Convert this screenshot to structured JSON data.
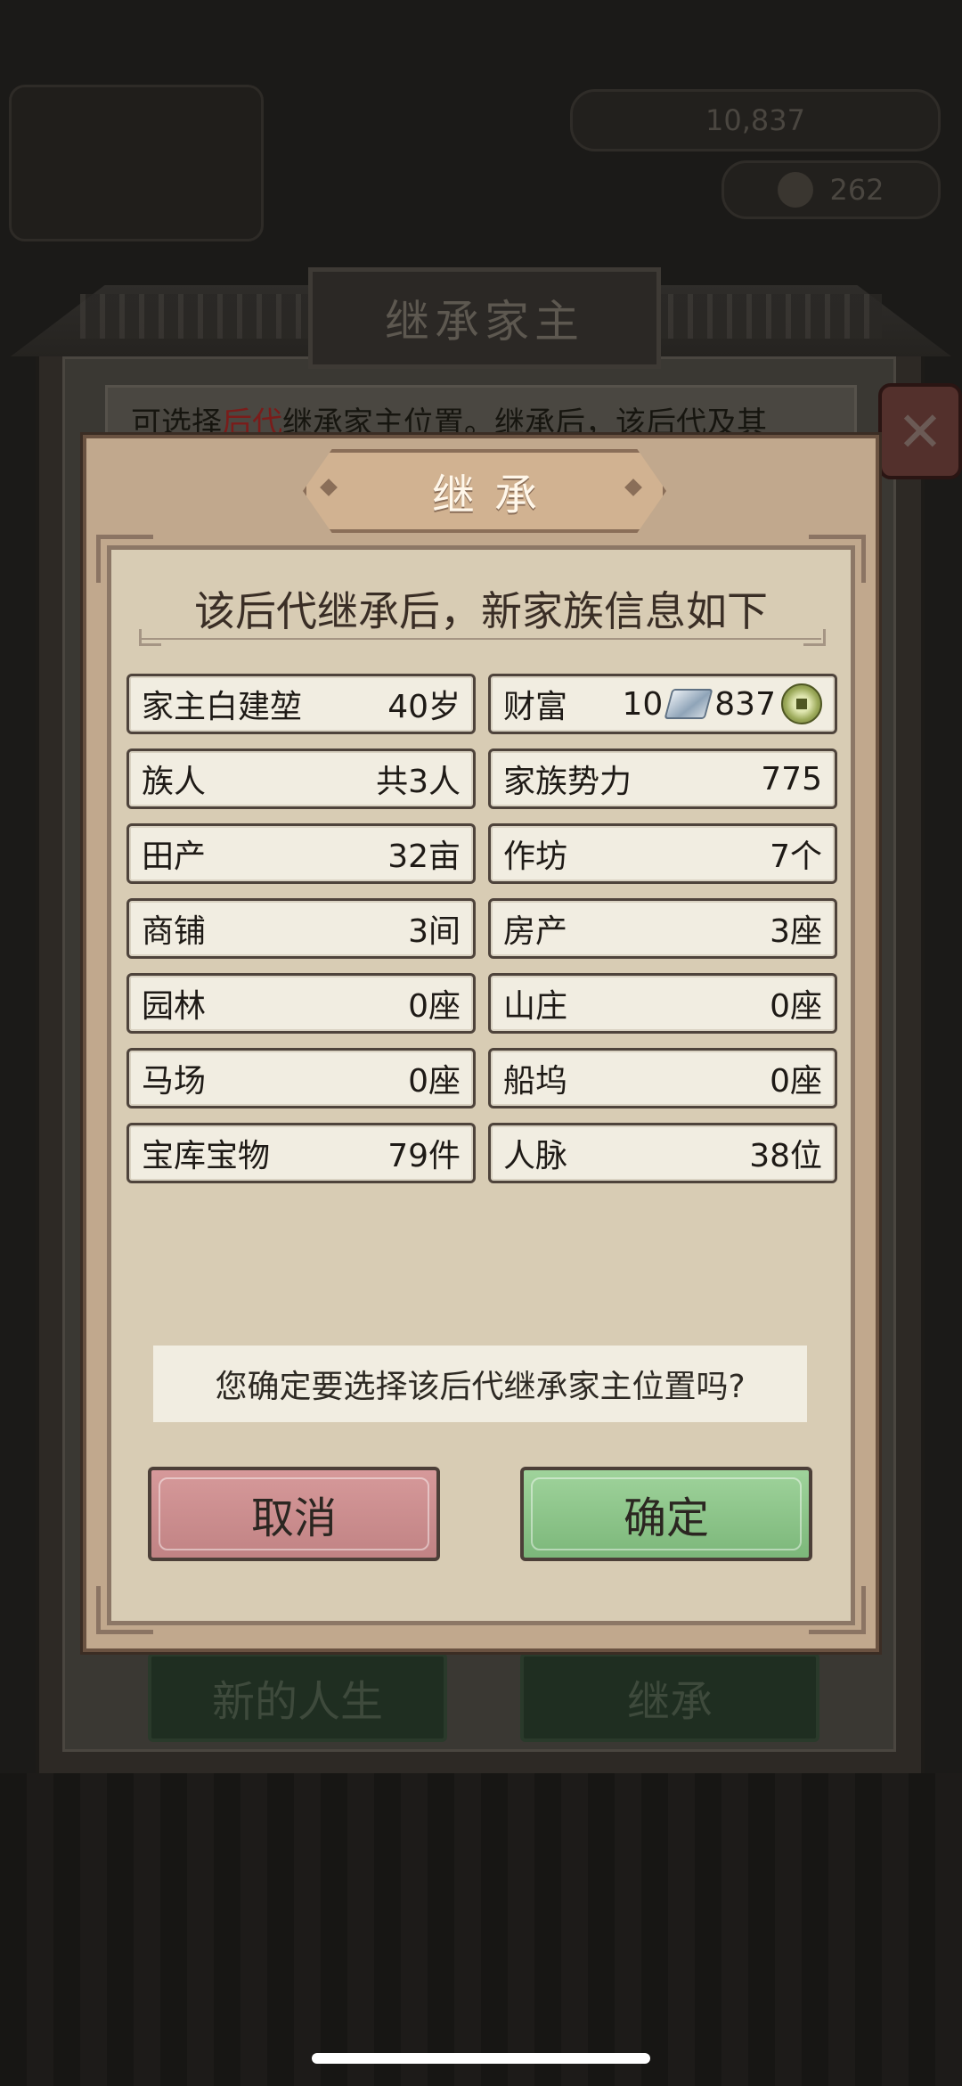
{
  "background": {
    "top_right_value": "10,837",
    "top_right_value2": "262",
    "outer_title": "继承家主",
    "outer_desc_prefix": "可选择",
    "outer_desc_highlight": "后代",
    "outer_desc_suffix": "继承家主位置。继承后，该后代及其",
    "close_icon": "✕",
    "bottom_buttons": [
      "新的人生",
      "继承"
    ]
  },
  "modal": {
    "title": "继承",
    "subtitle": "该后代继承后，新家族信息如下",
    "rows": [
      {
        "left_label": "家主白建堃",
        "left_value": "40岁",
        "right_label": "财富"
      },
      {
        "left_label": "族人",
        "left_value": "共3人",
        "right_label": "家族势力",
        "right_value": "775"
      },
      {
        "left_label": "田产",
        "left_value": "32亩",
        "right_label": "作坊",
        "right_value": "7个"
      },
      {
        "left_label": "商铺",
        "left_value": "3间",
        "right_label": "房产",
        "right_value": "3座"
      },
      {
        "left_label": "园林",
        "left_value": "0座",
        "right_label": "山庄",
        "right_value": "0座"
      },
      {
        "left_label": "马场",
        "left_value": "0座",
        "right_label": "船坞",
        "right_value": "0座"
      },
      {
        "left_label": "宝库宝物",
        "left_value": "79件",
        "right_label": "人脉",
        "right_value": "38位"
      }
    ],
    "wealth": {
      "silver": "10",
      "copper": "837",
      "silver_icon": "silver-ingot-icon",
      "copper_icon": "copper-coin-icon"
    },
    "question": "您确定要选择该后代继承家主位置吗?",
    "cancel_label": "取消",
    "confirm_label": "确定"
  }
}
